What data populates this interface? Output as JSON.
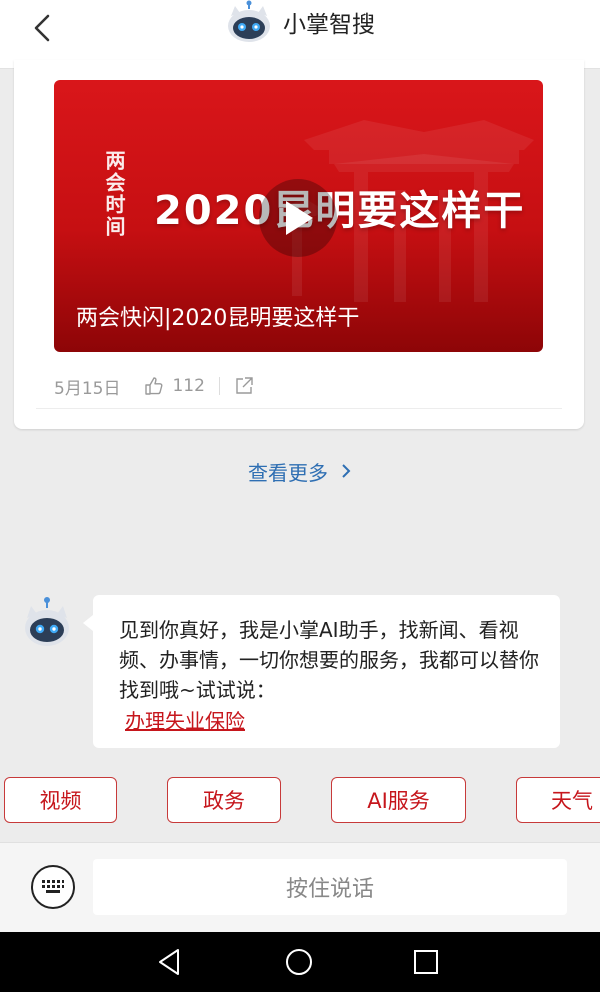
{
  "header": {
    "title": "小掌智搜"
  },
  "video_card": {
    "vertical_tag": "两会时间",
    "big_title": "2020昆明要这样干",
    "caption": "两会快闪|2020昆明要这样干",
    "date": "5月15日",
    "likes": "112"
  },
  "more": {
    "label": "查看更多"
  },
  "assistant": {
    "message": "见到你真好，我是小掌AI助手，找新闻、看视频、办事情，一切你想要的服务，我都可以替你找到哦~试试说：",
    "suggestion_link": "办理失业保险"
  },
  "chips": [
    "视频",
    "政务",
    "AI服务",
    "天气"
  ],
  "input": {
    "voice_label": "按住说话"
  },
  "colors": {
    "accent_red": "#c6161c",
    "link_blue": "#2f6fb3",
    "background": "#ececec"
  },
  "icons": [
    "back-arrow-icon",
    "robot-logo-icon",
    "play-icon",
    "thumbs-up-icon",
    "share-icon",
    "chevron-right-icon",
    "keyboard-icon",
    "nav-back-icon",
    "nav-home-icon",
    "nav-recents-icon"
  ]
}
